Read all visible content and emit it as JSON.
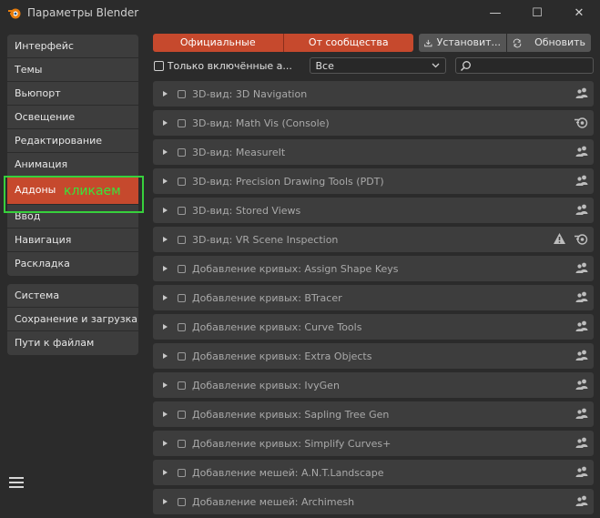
{
  "window": {
    "title": "Параметры Blender",
    "controls": [
      "—",
      "☐",
      "✕"
    ]
  },
  "sidebar": {
    "groups": [
      [
        {
          "label": "Интерфейс"
        },
        {
          "label": "Темы"
        },
        {
          "label": "Вьюпорт"
        },
        {
          "label": "Освещение"
        },
        {
          "label": "Редактирование"
        },
        {
          "label": "Анимация"
        },
        {
          "label": "Аддоны",
          "active": true
        },
        {
          "label": "Ввод"
        },
        {
          "label": "Навигация"
        },
        {
          "label": "Раскладка"
        }
      ],
      [
        {
          "label": "Система"
        },
        {
          "label": "Сохранение и загрузка"
        },
        {
          "label": "Пути к файлам"
        }
      ]
    ],
    "annotation": "кликаем"
  },
  "toolbar": {
    "official_label": "Официальные",
    "community_label": "От сообщества",
    "install_label": "Установит...",
    "refresh_label": "Обновить"
  },
  "filters": {
    "enabled_only_label": "Только включённые а...",
    "category_value": "Все",
    "search_value": ""
  },
  "addons": [
    {
      "name": "3D-вид: 3D Navigation",
      "icons": [
        "community-icon"
      ]
    },
    {
      "name": "3D-вид: Math Vis (Console)",
      "icons": [
        "blender-icon"
      ]
    },
    {
      "name": "3D-вид: MeasureIt",
      "icons": [
        "community-icon"
      ]
    },
    {
      "name": "3D-вид: Precision Drawing Tools (PDT)",
      "icons": [
        "community-icon"
      ]
    },
    {
      "name": "3D-вид: Stored Views",
      "icons": [
        "community-icon"
      ]
    },
    {
      "name": "3D-вид: VR Scene Inspection",
      "icons": [
        "warning-icon",
        "blender-icon"
      ]
    },
    {
      "name": "Добавление кривых: Assign Shape Keys",
      "icons": [
        "community-icon"
      ]
    },
    {
      "name": "Добавление кривых: BTracer",
      "icons": [
        "community-icon"
      ]
    },
    {
      "name": "Добавление кривых: Curve Tools",
      "icons": [
        "community-icon"
      ]
    },
    {
      "name": "Добавление кривых: Extra Objects",
      "icons": [
        "community-icon"
      ]
    },
    {
      "name": "Добавление кривых: IvyGen",
      "icons": [
        "community-icon"
      ]
    },
    {
      "name": "Добавление кривых: Sapling Tree Gen",
      "icons": [
        "community-icon"
      ]
    },
    {
      "name": "Добавление кривых: Simplify Curves+",
      "icons": [
        "community-icon"
      ]
    },
    {
      "name": "Добавление мешей: A.N.T.Landscape",
      "icons": [
        "community-icon"
      ]
    },
    {
      "name": "Добавление мешей: Archimesh",
      "icons": [
        "community-icon"
      ]
    }
  ],
  "colors": {
    "accent": "#c6492d",
    "annotation": "#3ae33a"
  }
}
